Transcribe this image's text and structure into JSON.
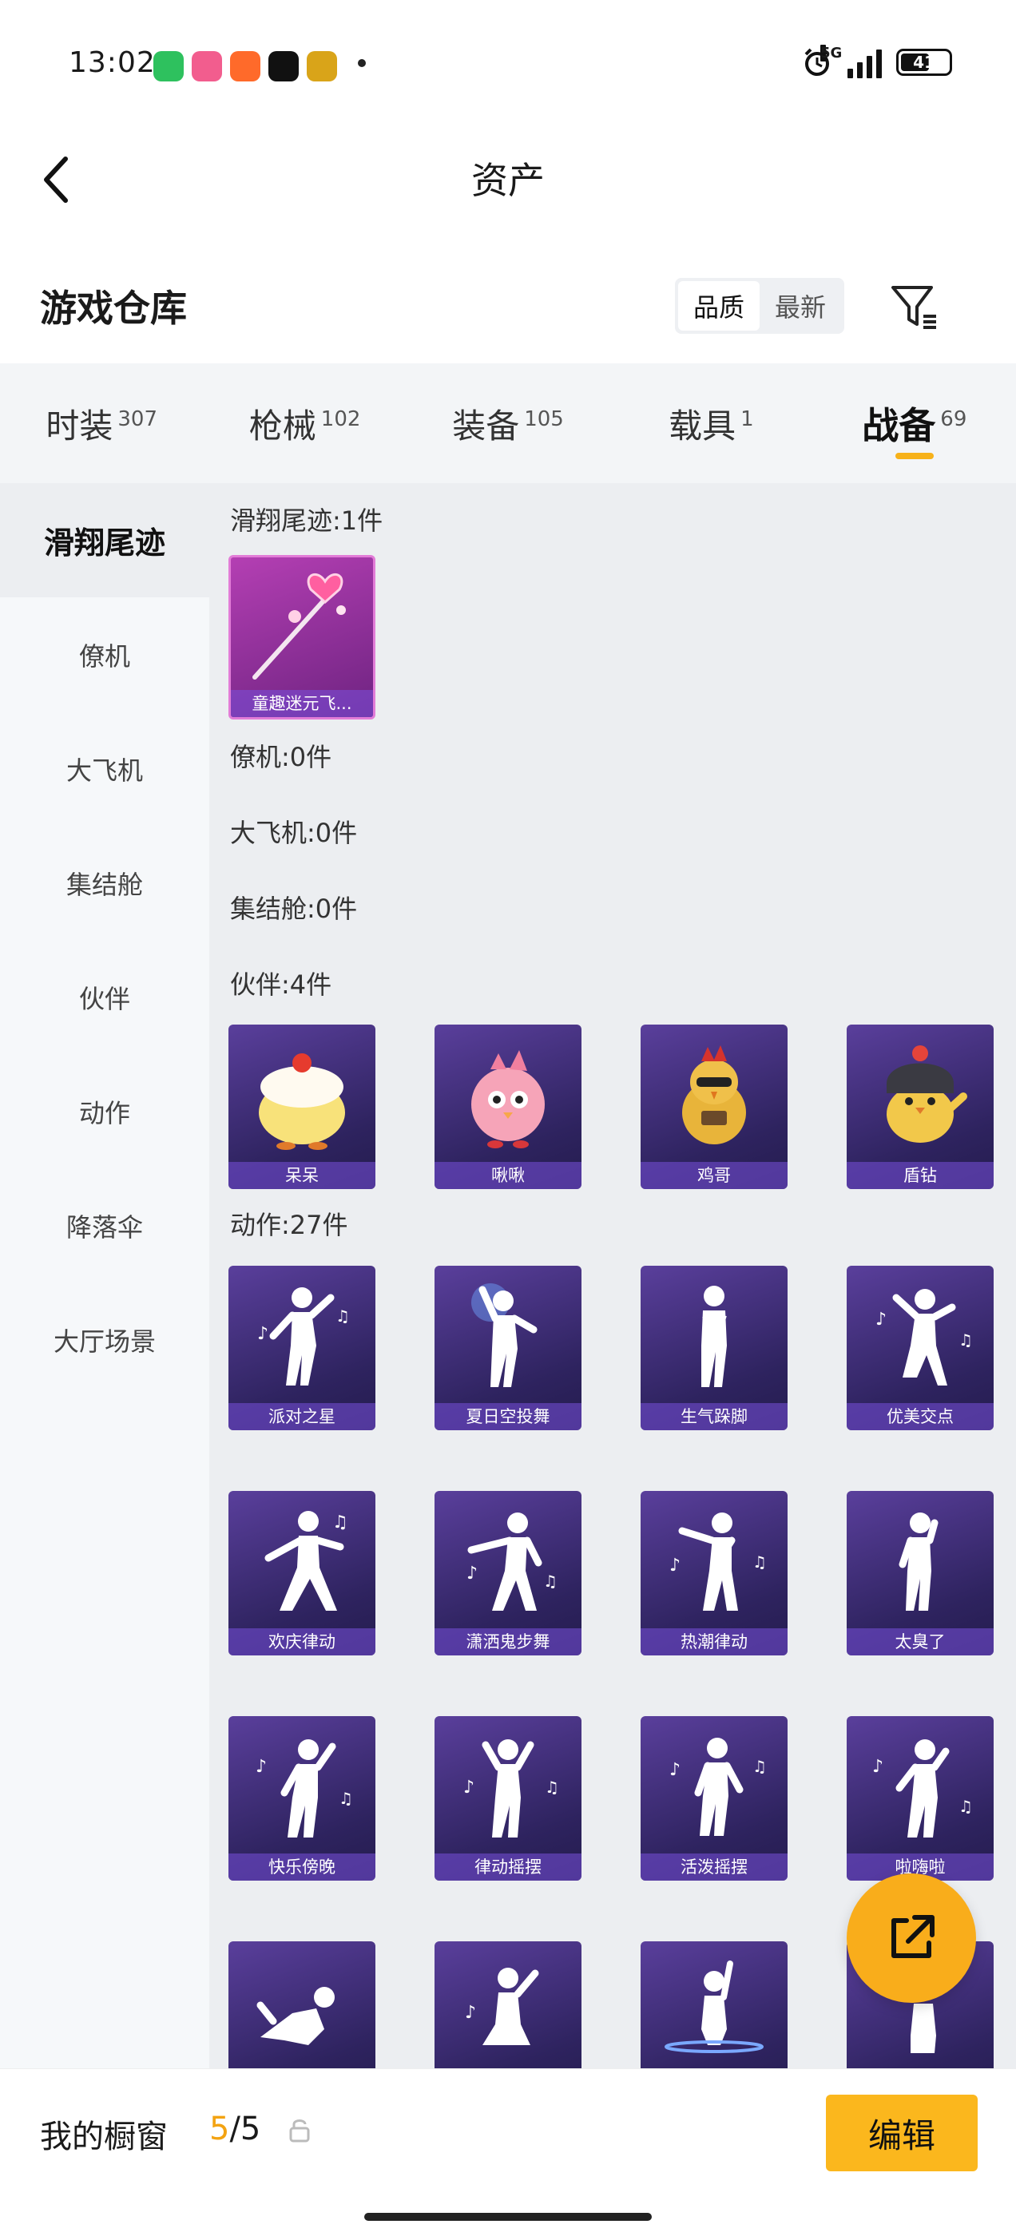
{
  "status_bar": {
    "time": "13:02",
    "network": "5G",
    "battery": "41",
    "apps": [
      {
        "name": "wechat-icon",
        "color": "#2ec15e"
      },
      {
        "name": "bilibili-icon",
        "color": "#f25d8e"
      },
      {
        "name": "app-orange-icon",
        "color": "#ff6a2a"
      },
      {
        "name": "douyin-icon",
        "color": "#111111"
      },
      {
        "name": "game-icon",
        "color": "#d9a419"
      }
    ]
  },
  "header": {
    "title": "资产"
  },
  "section": {
    "title": "游戏仓库",
    "sort": {
      "quality": "品质",
      "latest": "最新"
    }
  },
  "tabs": [
    {
      "label": "时装",
      "count": "307"
    },
    {
      "label": "枪械",
      "count": "102"
    },
    {
      "label": "装备",
      "count": "105"
    },
    {
      "label": "载具",
      "count": "1"
    },
    {
      "label": "战备",
      "count": "69"
    }
  ],
  "sidebar": [
    {
      "label": "滑翔尾迹"
    },
    {
      "label": "僚机"
    },
    {
      "label": "大飞机"
    },
    {
      "label": "集结舱"
    },
    {
      "label": "伙伴"
    },
    {
      "label": "动作"
    },
    {
      "label": "降落伞"
    },
    {
      "label": "大厅场景"
    }
  ],
  "groups": {
    "trail_title": "滑翔尾迹:1件",
    "wingman_title": "僚机:0件",
    "plane_title": "大飞机:0件",
    "capsule_title": "集结舱:0件",
    "partner_title": "伙伴:4件",
    "emote_title": "动作:27件"
  },
  "trail_items": [
    {
      "label": "童趣迷元飞..."
    }
  ],
  "partner_items": [
    {
      "label": "呆呆"
    },
    {
      "label": "啾啾"
    },
    {
      "label": "鸡哥"
    },
    {
      "label": "盾钻"
    }
  ],
  "emote_items": [
    {
      "label": "派对之星"
    },
    {
      "label": "夏日空投舞"
    },
    {
      "label": "生气跺脚"
    },
    {
      "label": "优美交点"
    },
    {
      "label": "欢庆律动"
    },
    {
      "label": "潇洒鬼步舞"
    },
    {
      "label": "热潮律动"
    },
    {
      "label": "太臭了"
    },
    {
      "label": "快乐傍晚"
    },
    {
      "label": "律动摇摆"
    },
    {
      "label": "活泼摇摆"
    },
    {
      "label": "啦嗨啦"
    },
    {
      "label": ""
    },
    {
      "label": ""
    },
    {
      "label": ""
    },
    {
      "label": ""
    }
  ],
  "bottom": {
    "showcase_label": "我的橱窗",
    "count_current": "5",
    "count_total": "/5",
    "edit_label": "编辑"
  },
  "colors": {
    "accent": "#fbb71d",
    "card_purple": "#3a2c7a",
    "card_pink": "#b43fb3"
  }
}
